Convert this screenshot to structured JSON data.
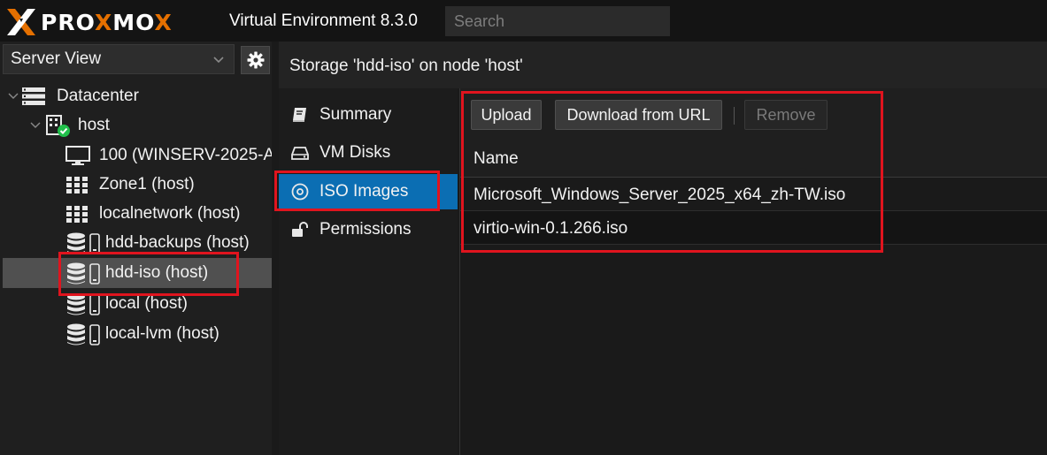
{
  "header": {
    "logo_text_a": "PRO",
    "logo_text_x": "X",
    "logo_text_b": "MO",
    "logo_text_c": "X",
    "app_title": "Virtual Environment 8.3.0",
    "search_placeholder": "Search"
  },
  "left_panel": {
    "view_selector": "Server View",
    "tree": [
      {
        "label": "Datacenter",
        "icon": "server-icon"
      },
      {
        "label": "host",
        "icon": "node-online-icon"
      },
      {
        "label": "100 (WINSERV-2025-A",
        "icon": "monitor-icon"
      },
      {
        "label": "Zone1 (host)",
        "icon": "grid-icon"
      },
      {
        "label": "localnetwork (host)",
        "icon": "grid-icon"
      },
      {
        "label": "hdd-backups (host)",
        "icon": "database-icon"
      },
      {
        "label": "hdd-iso (host)",
        "icon": "database-icon",
        "selected": true
      },
      {
        "label": "local (host)",
        "icon": "database-icon"
      },
      {
        "label": "local-lvm (host)",
        "icon": "database-icon"
      }
    ]
  },
  "main": {
    "title": "Storage 'hdd-iso' on node 'host'",
    "nav": [
      {
        "label": "Summary",
        "icon": "book-icon"
      },
      {
        "label": "VM Disks",
        "icon": "hdd-icon"
      },
      {
        "label": "ISO Images",
        "icon": "disc-icon",
        "active": true
      },
      {
        "label": "Permissions",
        "icon": "unlock-icon"
      }
    ],
    "toolbar": {
      "upload": "Upload",
      "download_url": "Download from URL",
      "remove": "Remove"
    },
    "grid": {
      "column_name": "Name",
      "rows": [
        "Microsoft_Windows_Server_2025_x64_zh-TW.iso",
        "virtio-win-0.1.266.iso"
      ]
    }
  },
  "colors": {
    "accent_orange": "#e57000",
    "selection_blue": "#0b6eb3",
    "annotation_red": "#e0141e",
    "online_green": "#21bf4b"
  }
}
